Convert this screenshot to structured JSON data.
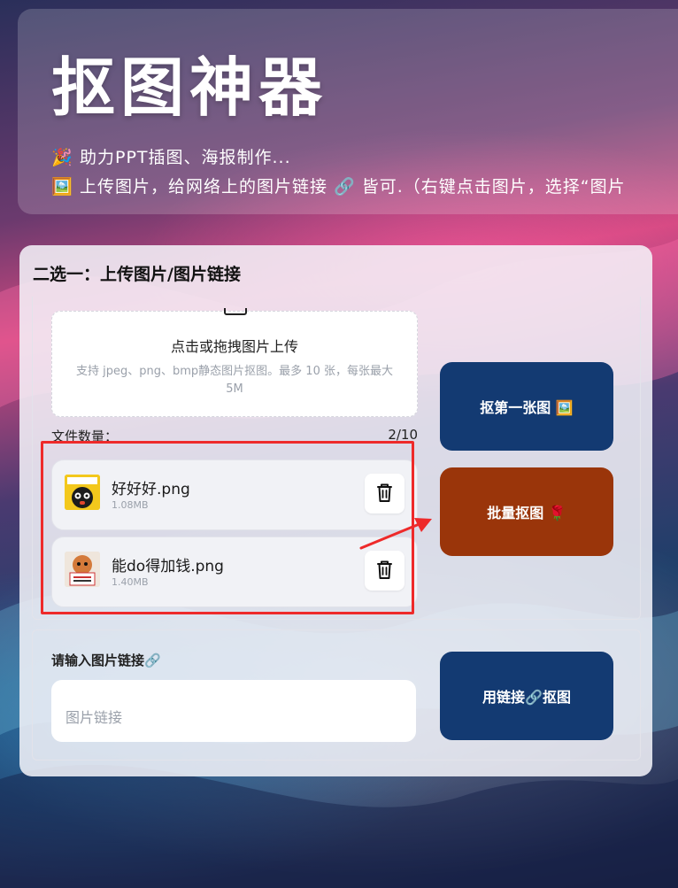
{
  "header": {
    "title": "抠图神器",
    "line1_icon": "🎉",
    "line1_text": "助力PPT插图、海报制作...",
    "line2_icon": "🖼️",
    "line2_text": "上传图片，给网络上的图片链接 🔗 皆可.（右键点击图片，选择“图片"
  },
  "panel": {
    "title": "二选一：上传图片/图片链接",
    "upload": {
      "main_text": "点击或拖拽图片上传",
      "hint_text": "支持 jpeg、png、bmp静态图片抠图。最多 10 张，每张最大 5M"
    },
    "file_count_label": "文件数量：",
    "file_count_value": "2/10",
    "files": [
      {
        "name": "好好好.png",
        "size": "1.08MB"
      },
      {
        "name": "能do得加钱.png",
        "size": "1.40MB"
      }
    ],
    "link_label": "请输入图片链接🔗",
    "link_placeholder": "图片链接"
  },
  "buttons": {
    "first": "抠第一张图 🖼️",
    "batch": "批量抠图 🌹",
    "link": "用链接🔗抠图"
  },
  "colors": {
    "primary_button": "#133a72",
    "batch_button": "#9a350a",
    "annotation_red": "#ee2a2a"
  },
  "icons": {
    "delete": "trash-icon",
    "upload": "upload-icon"
  }
}
